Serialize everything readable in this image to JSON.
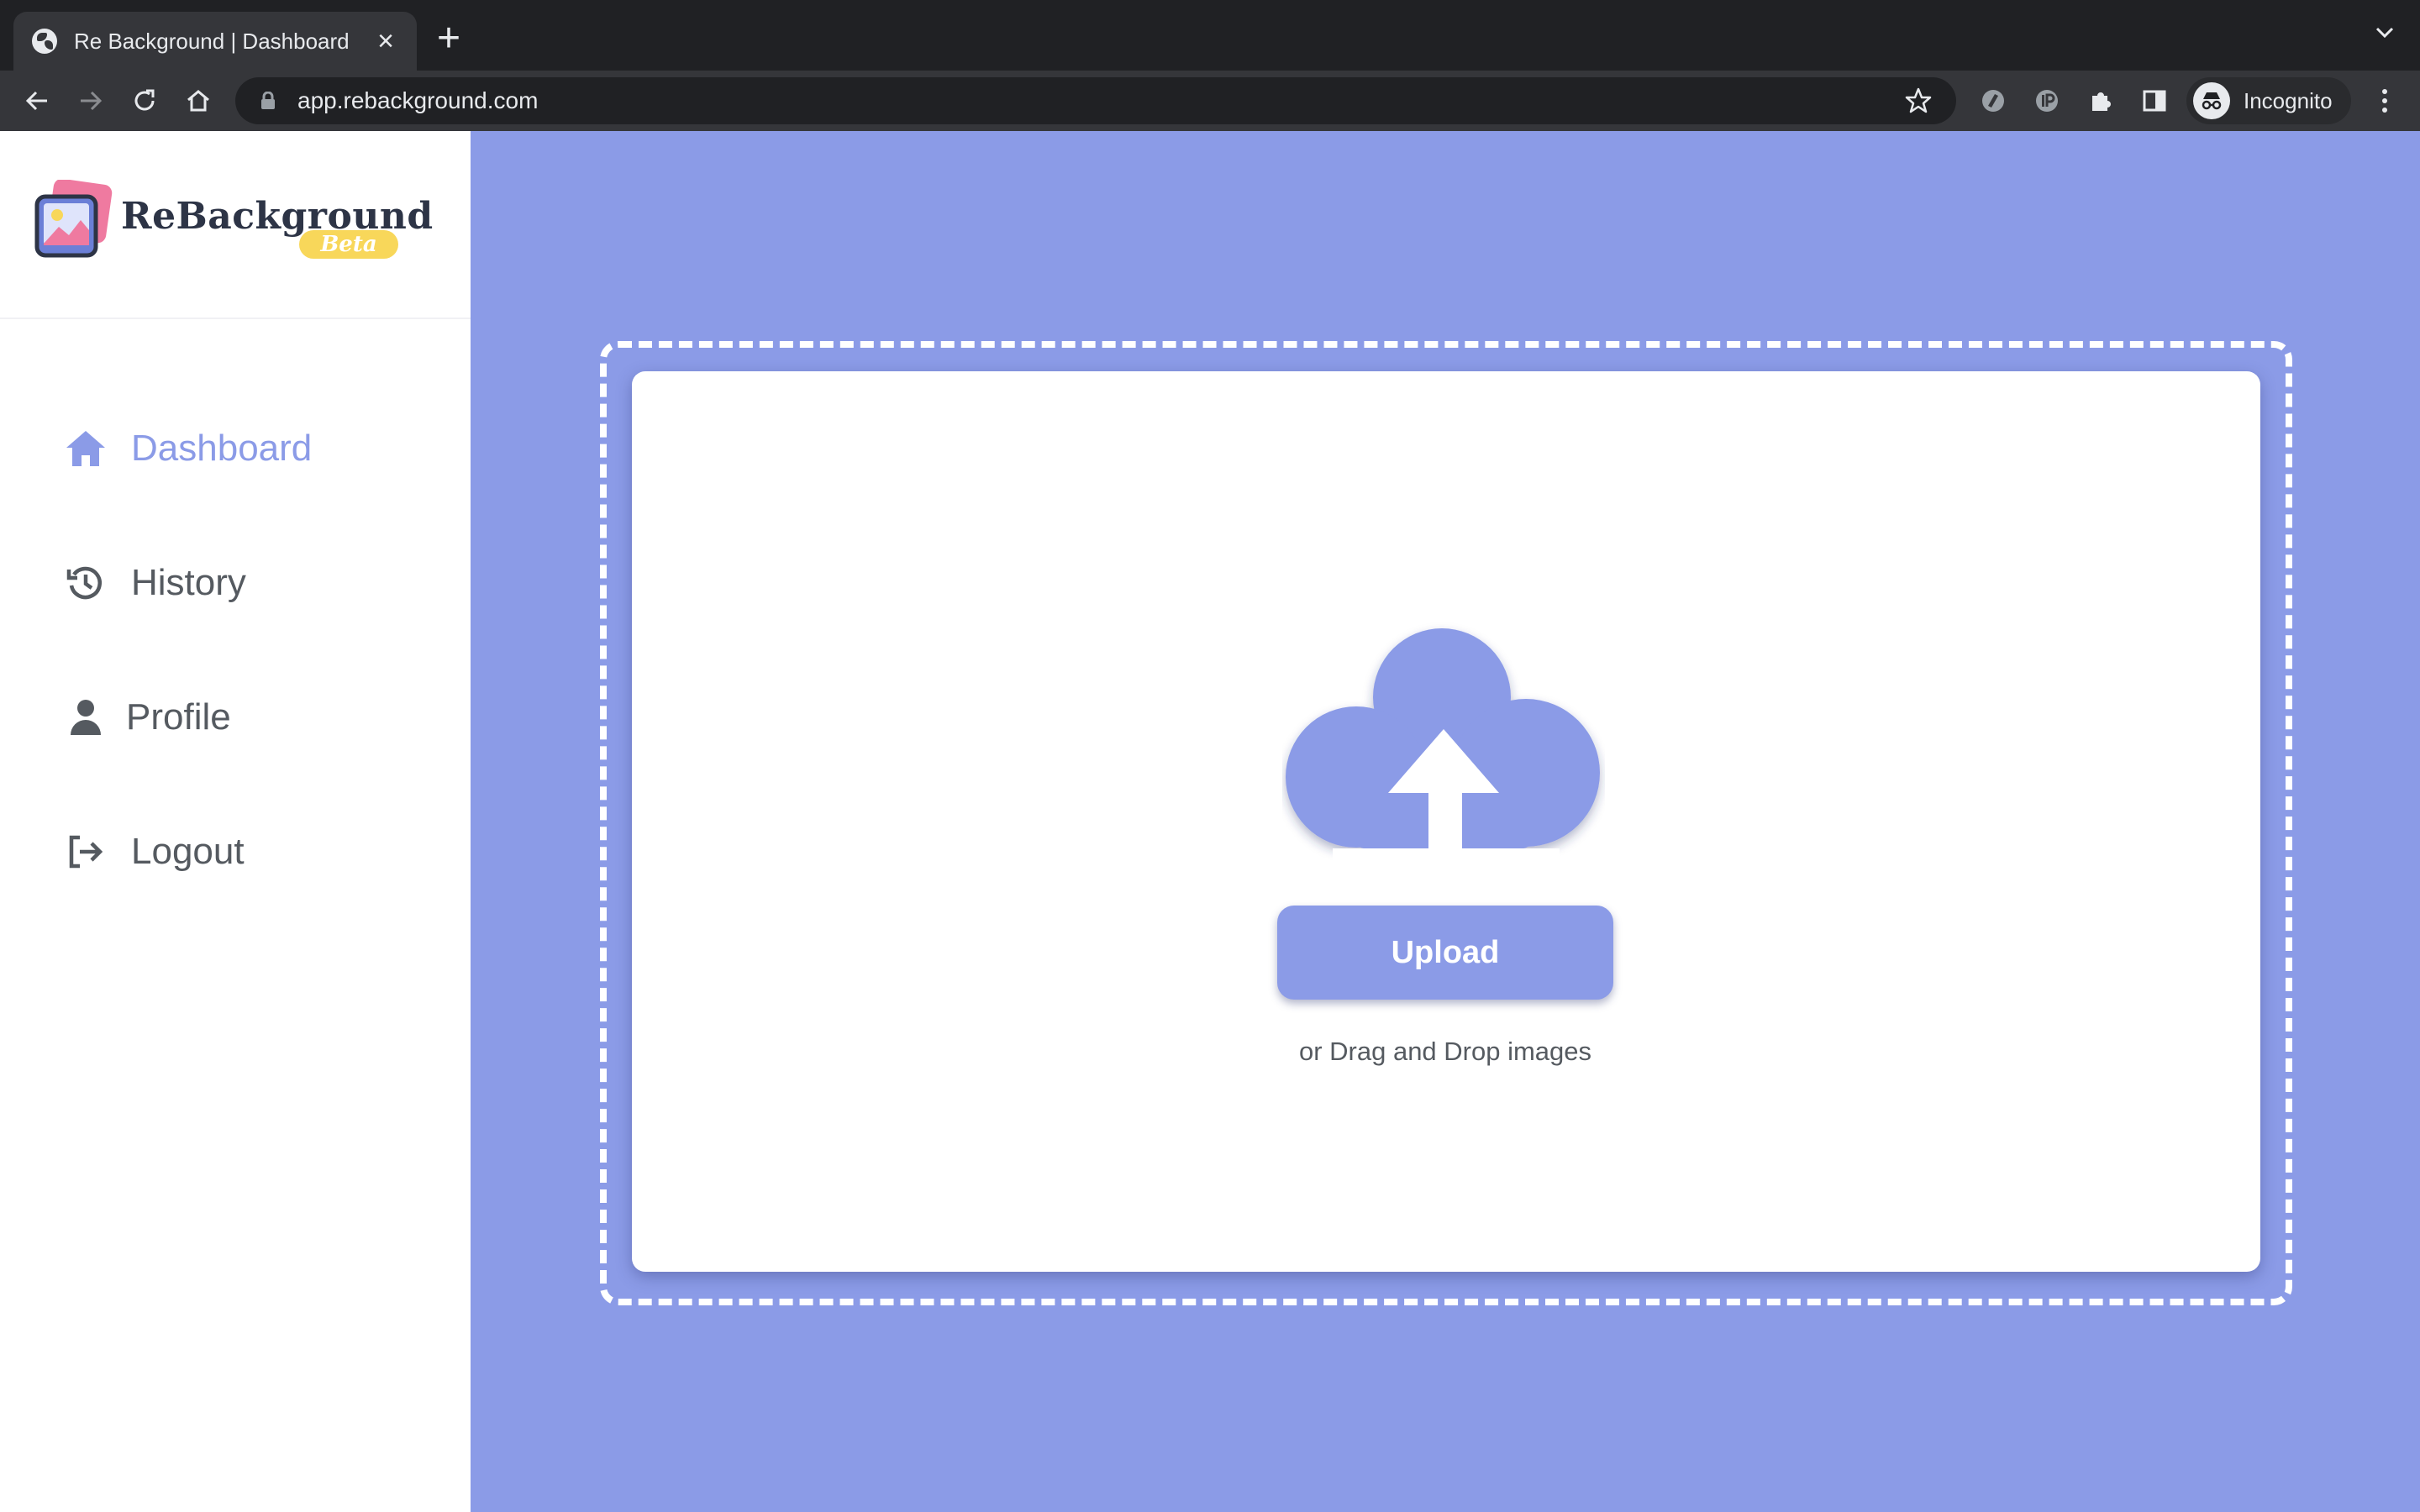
{
  "browser": {
    "tab_title": "Re Background | Dashboard",
    "url": "app.rebackground.com",
    "profile_label": "Incognito"
  },
  "sidebar": {
    "brand": "ReBackground",
    "badge": "Beta",
    "items": [
      {
        "label": "Dashboard",
        "icon": "home-icon",
        "active": true
      },
      {
        "label": "History",
        "icon": "history-icon",
        "active": false
      },
      {
        "label": "Profile",
        "icon": "user-icon",
        "active": false
      },
      {
        "label": "Logout",
        "icon": "logout-icon",
        "active": false
      }
    ]
  },
  "main": {
    "upload_label": "Upload",
    "hint": "or Drag and Drop images"
  },
  "colors": {
    "accent": "#8b9be7",
    "text": "#555a60",
    "brand_dark": "#2d3446",
    "badge": "#f8d75a"
  }
}
